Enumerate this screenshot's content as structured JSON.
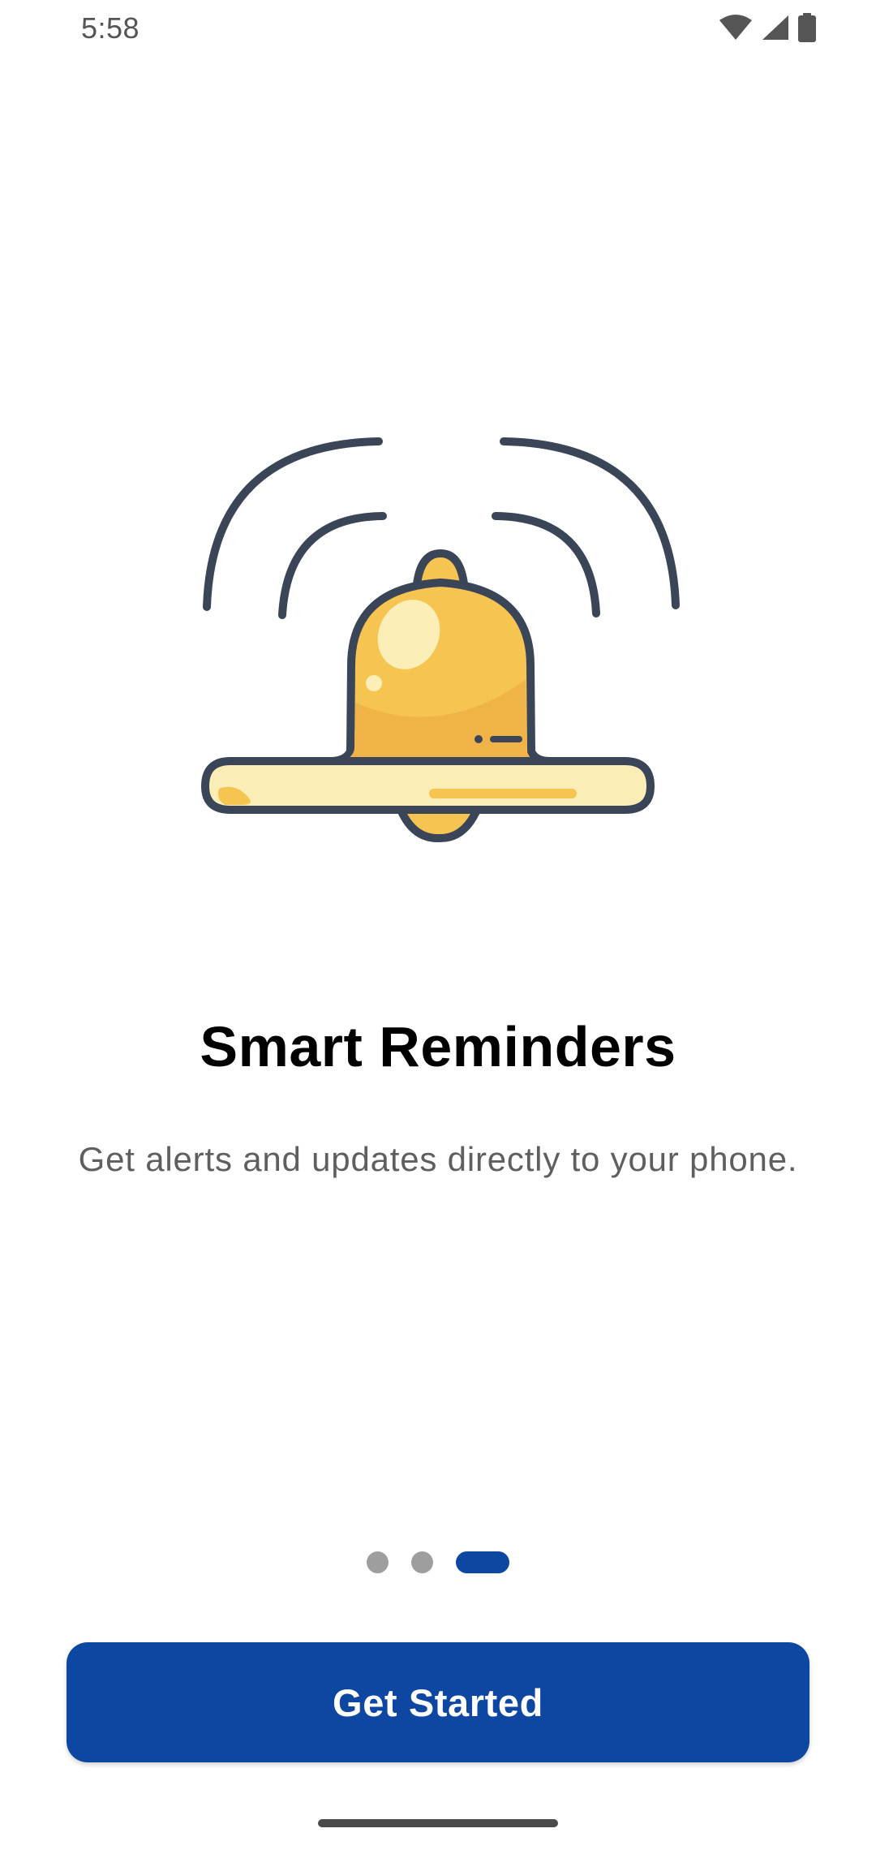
{
  "status_bar": {
    "time": "5:58",
    "icons": [
      "wifi-icon",
      "signal-icon",
      "battery-icon"
    ]
  },
  "onboarding": {
    "illustration": "bell-icon",
    "title": "Smart Reminders",
    "subtitle": "Get alerts and updates directly to your phone.",
    "page_count": 3,
    "active_page": 3
  },
  "cta": {
    "label": "Get Started"
  },
  "colors": {
    "primary": "#0d47a1",
    "bell_yellow": "#f5c451",
    "bell_outline": "#3b4558",
    "dot_inactive": "#9e9e9e"
  }
}
